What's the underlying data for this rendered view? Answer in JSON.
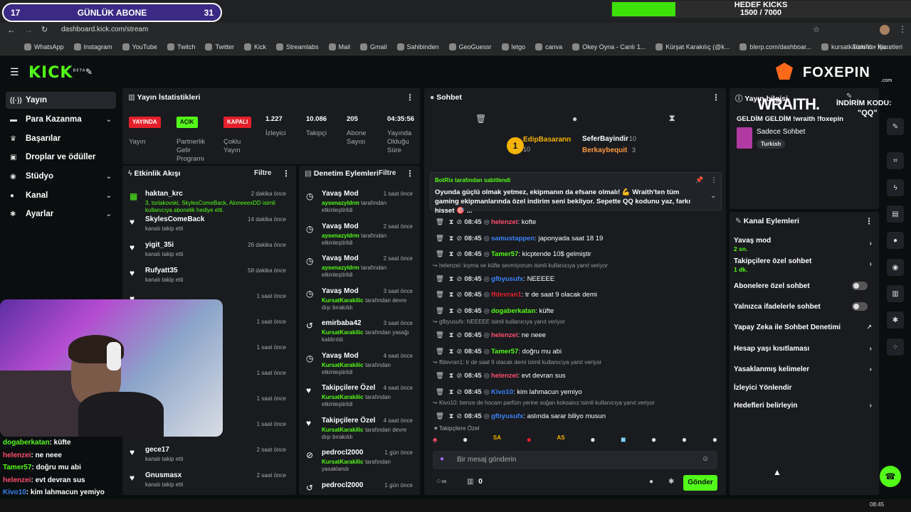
{
  "overlay": {
    "sub_count": "17",
    "sub_label": "GÜNLÜK ABONE",
    "sub_goal": "31",
    "goal_title": "HEDEF KICKS",
    "goal_progress": "1500 / 7000",
    "goal_fraction": 0.214
  },
  "browser": {
    "url": "dashboard.kick.com/stream",
    "bookmarks": [
      "WhatsApp",
      "Instagram",
      "YouTube",
      "Twitch",
      "Twitter",
      "Kick",
      "Streamlabs",
      "Mail",
      "Gmail",
      "Sahibinden",
      "GeoGuessr",
      "letgo",
      "canva",
      "Okey Oyna - Canlı 1...",
      "Kürşat Karakılıç (@k...",
      "blerp.com/dashboar...",
      "kursatkarakilic - Kic..."
    ],
    "all_bookmarks": "Tüm Yer İşaretleri"
  },
  "app": {
    "logo": "KICK",
    "logo_sup": "BETA"
  },
  "sidebar": {
    "items": [
      {
        "label": "Yayın"
      },
      {
        "label": "Para Kazanma"
      },
      {
        "label": "Başarılar"
      },
      {
        "label": "Droplar ve ödüller"
      },
      {
        "label": "Stüdyo"
      },
      {
        "label": "Kanal"
      },
      {
        "label": "Ayarlar"
      }
    ]
  },
  "stats": {
    "title": "Yayın İstatistikleri",
    "badges": [
      {
        "badge": "YAYINDA",
        "label": "Yayın",
        "color": "#e5202b"
      },
      {
        "badge": "AÇIK",
        "label": "Partnerlik Gelir Programı",
        "color": "#53fc18"
      },
      {
        "badge": "KAPALI",
        "label": "Çoklu Yayın",
        "color": "#e5202b"
      }
    ],
    "values": [
      {
        "value": "1.227",
        "label": "İzleyici"
      },
      {
        "value": "10.086",
        "label": "Takipçi"
      },
      {
        "value": "205",
        "label": "Abone Sayısı"
      },
      {
        "value": "04:35:56",
        "label": "Yayında Olduğu Süre"
      }
    ]
  },
  "activity": {
    "title": "Etkinlik Akışı",
    "filter": "Filtre",
    "items": [
      {
        "name": "haktan_krc",
        "sub": "3, torlakovski, SkylesComeBack, AloneeexDD isimli kullanıcıya abonelik hediye etti.",
        "time": "2 dakika önce"
      },
      {
        "name": "SkylesComeBack",
        "sub": "kanalı takip etti",
        "time": "14 dakika önce"
      },
      {
        "name": "yigit_35i",
        "sub": "kanalı takip etti",
        "time": "26 dakika önce"
      },
      {
        "name": "Rufyatt35",
        "sub": "kanalı takip etti",
        "time": "58 dakika önce"
      },
      {
        "name": "",
        "sub": "",
        "time": "1 saat önce"
      },
      {
        "name": "",
        "sub": "",
        "time": "1 saat önce"
      },
      {
        "name": "",
        "sub": "",
        "time": "1 saat önce"
      },
      {
        "name": "",
        "sub": "",
        "time": "1 saat önce"
      },
      {
        "name": "",
        "sub": "",
        "time": "1 saat önce"
      },
      {
        "name": "basit1analizz",
        "sub": "kanalı takip etti",
        "time": "1 saat önce"
      },
      {
        "name": "gece17",
        "sub": "kanalı takip etti",
        "time": "2 saat önce"
      },
      {
        "name": "Gnusmasx",
        "sub": "kanalı takip etti",
        "time": "2 saat önce"
      }
    ]
  },
  "moderation": {
    "title": "Denetim Eylemleri",
    "filter": "Filtre",
    "items": [
      {
        "name": "Yavaş Mod",
        "actor": "aysenazyldrm",
        "sub": "tarafından etkinleştirildi",
        "time": "1 saat önce"
      },
      {
        "name": "Yavaş Mod",
        "actor": "aysenazyldrm",
        "sub": "tarafından etkinleştirildi",
        "time": "2 saat önce"
      },
      {
        "name": "Yavaş Mod",
        "actor": "aysenazyldrm",
        "sub": "tarafından etkinleştirildi",
        "time": "2 saat önce"
      },
      {
        "name": "Yavaş Mod",
        "actor": "KursatKarakilic",
        "sub": "tarafından devre dışı bırakıldı",
        "time": "3 saat önce"
      },
      {
        "name": "emirbaba42",
        "actor": "KursatKarakilic",
        "sub": "tarafından yasağı kaldırıldı",
        "time": "3 saat önce"
      },
      {
        "name": "Yavaş Mod",
        "actor": "KursatKarakilic",
        "sub": "tarafından etkinleştirildi",
        "time": "4 saat önce"
      },
      {
        "name": "Takipçilere Özel",
        "actor": "KursatKarakilic",
        "sub": "tarafından etkinleştirildi",
        "time": "4 saat önce"
      },
      {
        "name": "Takipçilere Özel",
        "actor": "KursatKarakilic",
        "sub": "tarafından devre dışı bırakıldı",
        "time": "4 saat önce"
      },
      {
        "name": "pedrocl2000",
        "actor": "KursatKarakilic",
        "sub": "tarafından yasaklandı",
        "time": "1 gün önce"
      },
      {
        "name": "pedrocl2000",
        "actor": "",
        "sub": "",
        "time": "1 gün önce"
      }
    ]
  },
  "chat": {
    "title": "Sohbet",
    "top_gifters": [
      {
        "name": "EdipBasarann",
        "count": "10"
      },
      {
        "name": "SeferBayindir",
        "count": "10"
      },
      {
        "name": "Berkaybequit",
        "count": "3"
      }
    ],
    "pinned_by": "BotRix tarafından sabitlendi",
    "pinned_text": "Oyunda güçlü olmak yetmez, ekipmanın da efsane olmalı! 💪 Wraith'ten tüm gaming ekipmanlarında özel indirim seni bekliyor. Sepette QQ kodunu yaz, farkı hisset 🎯 ...",
    "messages": [
      {
        "time": "08:45",
        "user": "helenzei",
        "color": "#ff4d6d",
        "text": ": kofte"
      },
      {
        "time": "08:45",
        "user": "samustappen",
        "color": "#3b82f6",
        "text": ": japonyada saat 18 19"
      },
      {
        "time": "08:45",
        "user": "Tamer57",
        "color": "#53fc18",
        "text": ": kicptende 10$ gelmiştir"
      },
      {
        "time": "08:45",
        "user": "gfbyusufx",
        "color": "#3b82f6",
        "text": ": NEEEEE",
        "reply": "helenzei: kıyma ve küfte sevmiyorum isimli kullanıcıya yanıt veriyor"
      },
      {
        "time": "08:45",
        "user": "ffdevran1",
        "color": "#e5202b",
        "text": ": tr de saat 9 olacak demi"
      },
      {
        "time": "08:45",
        "user": "dogaberkatan",
        "color": "#53fc18",
        "text": ": küfte"
      },
      {
        "time": "08:45",
        "user": "helenzei",
        "color": "#ff4d6d",
        "text": ": ne neee",
        "reply": "gfbyusufx: NEEEEE isimli kullanıcıya yanıt veriyor"
      },
      {
        "time": "08:45",
        "user": "Tamer57",
        "color": "#53fc18",
        "text": ": doğru mu abi"
      },
      {
        "time": "08:45",
        "user": "helenzei",
        "color": "#ff4d6d",
        "text": ": evt devran sus",
        "reply": "ffdevran1: tr de saat 9 olacak demi isimli kullanıcıya yanıt veriyor"
      },
      {
        "time": "08:45",
        "user": "Kivo10",
        "color": "#3b82f6",
        "text": ": kim lahmacun yemiyo"
      },
      {
        "time": "08:45",
        "user": "gfbyusufx",
        "color": "#3b82f6",
        "text": ": aslında sarar biliyo musun",
        "reply": "Kivo10: bence de hocam parfüm yerine soğan koksanız isimli kullanıcıya yanıt veriyor"
      }
    ],
    "follower_only": "Takipçilere Özel",
    "input_placeholder": "Bir mesaj gönderin",
    "viewer_count": "0",
    "send": "Gönder"
  },
  "stream_info": {
    "title": "Yayın bilgisi",
    "stream_title": "GELDİM GELDİM !wraith !foxepin",
    "category": "Sadece Sohbet",
    "tag": "Turkish"
  },
  "sponsor": {
    "brand": "FOXEPIN",
    "domain": ".com",
    "wraith": "WRAITH.",
    "code_label": "İNDİRİM KODU:",
    "code": "\"QQ\""
  },
  "channel_actions": {
    "title": "Kanal Eylemleri",
    "items": [
      {
        "label": "Yavaş mod",
        "sub": "2 sn.",
        "type": "chevron"
      },
      {
        "label": "Takipçilere özel sohbet",
        "sub": "1 dk.",
        "type": "chevron"
      },
      {
        "label": "Abonelere özel sohbet",
        "sub": "",
        "type": "toggle"
      },
      {
        "label": "Yalnızca ifadelerle sohbet",
        "sub": "",
        "type": "toggle"
      },
      {
        "label": "Yapay Zeka ile Sohbet Denetimi",
        "sub": "",
        "type": "external"
      },
      {
        "label": "Hesap yaşı kısıtlaması",
        "sub": "",
        "type": "chevron"
      },
      {
        "label": "Yasaklanmış kelimeler",
        "sub": "",
        "type": "chevron"
      },
      {
        "label": "İzleyici Yönlendir",
        "sub": "",
        "type": "none"
      },
      {
        "label": "Hedefleri belirleyin",
        "sub": "",
        "type": "chevron"
      }
    ]
  },
  "stream_overlay_chat": [
    {
      "user": "dogaberkatan",
      "color": "#53fc18",
      "text": ": küfte"
    },
    {
      "user": "helenzei",
      "color": "#ff4d6d",
      "text": ": ne neee"
    },
    {
      "user": "Tamer57",
      "color": "#53fc18",
      "text": ": doğru mu abi"
    },
    {
      "user": "helenzei",
      "color": "#ff4d6d",
      "text": ": evt devran sus"
    },
    {
      "user": "Kivo10",
      "color": "#3b82f6",
      "text": ": kim lahmacun yemiyo"
    },
    {
      "user": "gfbyusufx",
      "color": "#3b82f6",
      "text": ": aslında sarar biliyo musun"
    }
  ],
  "taskbar": {
    "time": "08:45"
  }
}
